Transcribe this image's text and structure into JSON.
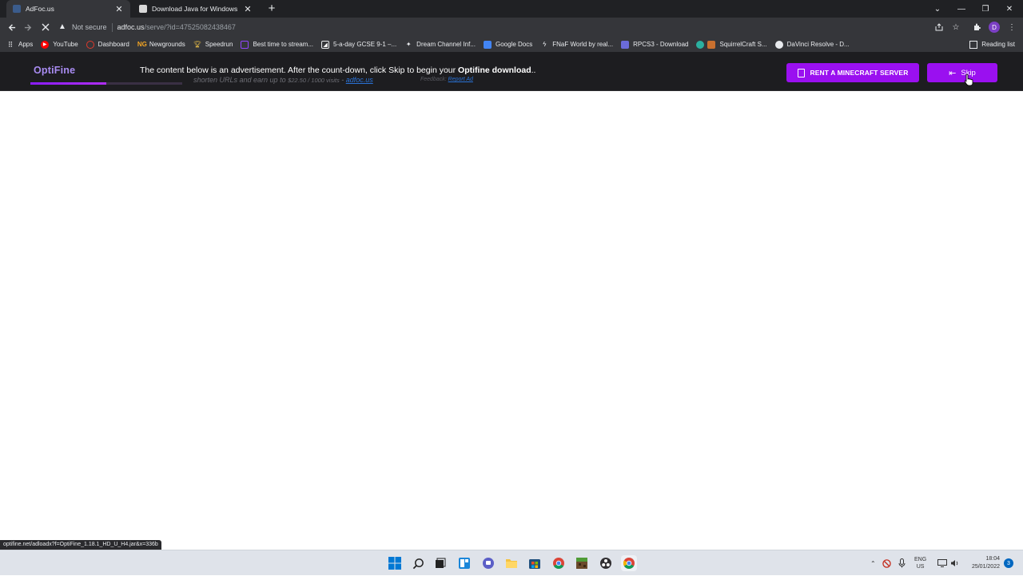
{
  "browser": {
    "tabs": [
      {
        "title": "AdFoc.us",
        "active": true
      },
      {
        "title": "Download Java for Windows",
        "active": false
      }
    ],
    "new_tab": "+",
    "address": {
      "security": "Not secure",
      "host": "adfoc.us",
      "path": "/serve/?id=47525082438467"
    },
    "profile_initial": "D",
    "bookmarks": [
      "Apps",
      "YouTube",
      "Dashboard",
      "Newgrounds",
      "Speedrun",
      "Best time to stream...",
      "5-a-day GCSE 9-1 –...",
      "Dream Channel Inf...",
      "Google Docs",
      "FNaF World by real...",
      "RPCS3 - Download",
      "SquirrelCraft S...",
      "DaVinci Resolve - D..."
    ],
    "reading_list": "Reading list"
  },
  "adbar": {
    "brand": "OptiFine",
    "progress": 0.5,
    "message_prefix": "The content below is an advertisement. After the count-down, click Skip to begin your ",
    "message_bold": "Optifine download",
    "message_suffix": "..",
    "sub_prefix": "shorten URLs and earn up to ",
    "sub_amount": "$22.50 / 1000 visits",
    "sub_sep": " - ",
    "sub_link": "adfoc.us",
    "feedback_label": "Feedback: ",
    "feedback_link": "Report Ad",
    "rent_button": "RENT A MINECRAFT SERVER",
    "skip_button": "Skip"
  },
  "status_url": "optifine.net/adloadx?f=OptiFine_1.18.1_HD_U_H4.jar&x=336b",
  "taskbar": {
    "lang_line1": "ENG",
    "lang_line2": "US",
    "time": "18:04",
    "date": "25/01/2022",
    "notification_count": "3"
  }
}
